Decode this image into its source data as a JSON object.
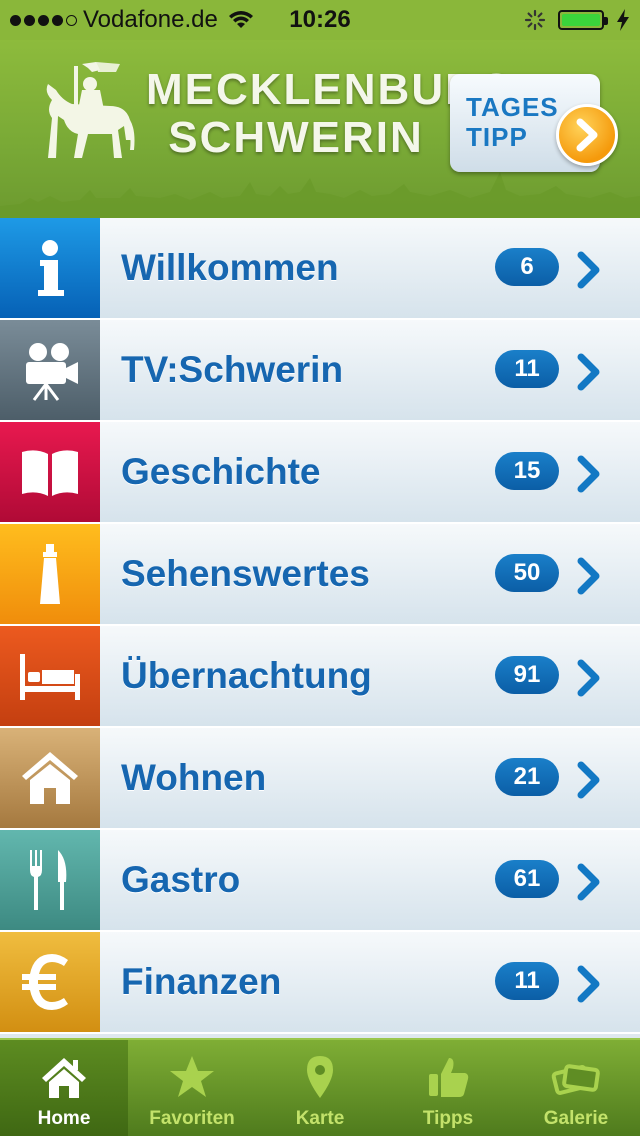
{
  "status_bar": {
    "carrier": "Vodafone.de",
    "time": "10:26"
  },
  "header": {
    "brand_line1": "MECKLENBURG",
    "brand_line2": "SCHWERIN",
    "tages_line1": "TAGES",
    "tages_line2": "TIPP"
  },
  "menu": [
    {
      "label": "Willkommen",
      "count": "6",
      "icon": "info-icon",
      "color_top": "#1e9ae6",
      "color_bottom": "#0661b6"
    },
    {
      "label": "TV:Schwerin",
      "count": "11",
      "icon": "film-camera-icon",
      "color_top": "#7a8c98",
      "color_bottom": "#4d5e69"
    },
    {
      "label": "Geschichte",
      "count": "15",
      "icon": "open-book-icon",
      "color_top": "#e8194f",
      "color_bottom": "#b00a36"
    },
    {
      "label": "Sehenswertes",
      "count": "50",
      "icon": "lighthouse-icon",
      "color_top": "#ffbd1e",
      "color_bottom": "#f08d0b"
    },
    {
      "label": "Übernachtung",
      "count": "91",
      "icon": "bed-icon",
      "color_top": "#ec5a1f",
      "color_bottom": "#c43f10"
    },
    {
      "label": "Wohnen",
      "count": "21",
      "icon": "house-icon",
      "color_top": "#d9b278",
      "color_bottom": "#a5793f"
    },
    {
      "label": "Gastro",
      "count": "61",
      "icon": "fork-knife-icon",
      "color_top": "#62b7ae",
      "color_bottom": "#3d8a82"
    },
    {
      "label": "Finanzen",
      "count": "11",
      "icon": "euro-icon",
      "color_top": "#f0bd3f",
      "color_bottom": "#d28f12"
    }
  ],
  "tabs": [
    {
      "label": "Home",
      "icon": "home-icon",
      "active": true
    },
    {
      "label": "Favoriten",
      "icon": "star-icon",
      "active": false
    },
    {
      "label": "Karte",
      "icon": "map-pin-icon",
      "active": false
    },
    {
      "label": "Tipps",
      "icon": "thumbs-up-icon",
      "active": false
    },
    {
      "label": "Galerie",
      "icon": "photos-icon",
      "active": false
    }
  ]
}
